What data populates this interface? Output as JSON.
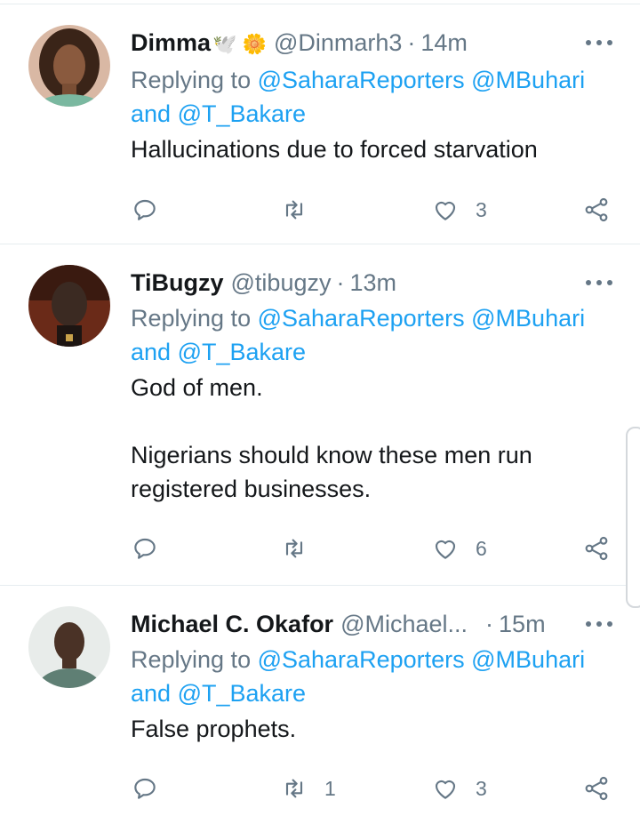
{
  "tweets": [
    {
      "name": "Dimma",
      "emoji": "🕊️ 🌼",
      "handle": "@Dinmarh3",
      "separator": "·",
      "time": "14m",
      "replying_prefix": "Replying to ",
      "mention1": "@SaharaReporters",
      "mention2": "@MBuhari",
      "and_word": "and ",
      "mention3": "@T_Bakare",
      "text": "Hallucinations due to forced starvation",
      "reply_count": "",
      "retweet_count": "",
      "like_count": "3"
    },
    {
      "name": "TiBugzy",
      "emoji": "",
      "handle": "@tibugzy",
      "separator": "·",
      "time": "13m",
      "replying_prefix": "Replying to ",
      "mention1": "@SaharaReporters",
      "mention2": "@MBuhari",
      "and_word": "and ",
      "mention3": "@T_Bakare",
      "text": "God of men.\n\nNigerians should know these men run registered businesses.",
      "reply_count": "",
      "retweet_count": "",
      "like_count": "6"
    },
    {
      "name": "Michael C. Okafor",
      "emoji": "",
      "handle": "@Michael...",
      "separator": "·",
      "time": "15m",
      "replying_prefix": "Replying to ",
      "mention1": "@SaharaReporters",
      "mention2": "@MBuhari",
      "and_word": "and ",
      "mention3": "@T_Bakare",
      "text": "False prophets.",
      "reply_count": "",
      "retweet_count": "1",
      "like_count": "3"
    }
  ],
  "colors": {
    "link": "#1da1f2",
    "secondary_text": "#657786",
    "primary_text": "#14171a",
    "divider": "#e6ecf0"
  },
  "icons": [
    "reply-icon",
    "retweet-icon",
    "like-icon",
    "share-icon",
    "more-options-icon"
  ]
}
